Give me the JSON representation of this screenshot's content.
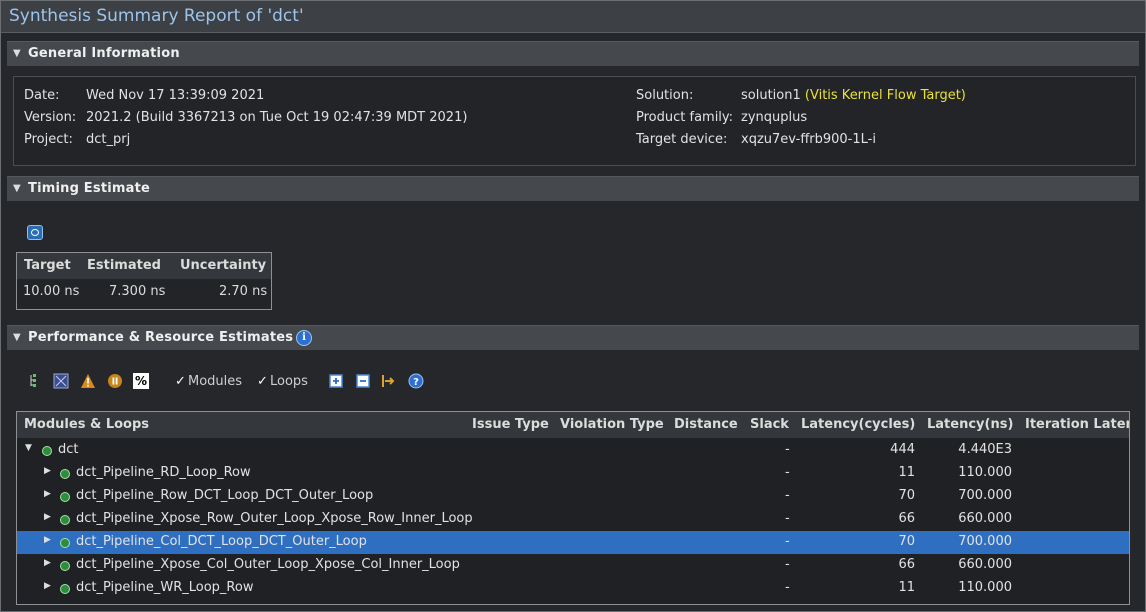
{
  "title": "Synthesis Summary Report of 'dct'",
  "sections": {
    "general": "General Information",
    "timing": "Timing Estimate",
    "perf": "Performance & Resource Estimates"
  },
  "general": {
    "date_label": "Date:",
    "date_value": "Wed Nov 17 13:39:09 2021",
    "version_label": "Version:",
    "version_value": "2021.2 (Build 3367213 on Tue Oct 19 02:47:39 MDT 2021)",
    "project_label": "Project:",
    "project_value": "dct_prj",
    "solution_label": "Solution:",
    "solution_value": "solution1",
    "solution_extra": "(Vitis Kernel Flow Target)",
    "family_label": "Product family:",
    "family_value": "zynquplus",
    "device_label": "Target device:",
    "device_value": "xqzu7ev-ffrb900-1L-i"
  },
  "timing": {
    "headers": [
      "Target",
      "Estimated",
      "Uncertainty"
    ],
    "values": [
      "10.00 ns",
      "7.300 ns",
      "2.70 ns"
    ]
  },
  "toolbar": {
    "modules_label": "Modules",
    "loops_label": "Loops",
    "percent_label": "%"
  },
  "tree": {
    "headers": [
      "Modules & Loops",
      "Issue Type",
      "Violation Type",
      "Distance",
      "Slack",
      "Latency(cycles)",
      "Latency(ns)",
      "Iteration Latency"
    ],
    "root": {
      "name": "dct",
      "slack": "-",
      "cycles": "444",
      "ns": "4.440E3"
    },
    "rows": [
      {
        "name": "dct_Pipeline_RD_Loop_Row",
        "slack": "-",
        "cycles": "11",
        "ns": "110.000"
      },
      {
        "name": "dct_Pipeline_Row_DCT_Loop_DCT_Outer_Loop",
        "slack": "-",
        "cycles": "70",
        "ns": "700.000"
      },
      {
        "name": "dct_Pipeline_Xpose_Row_Outer_Loop_Xpose_Row_Inner_Loop",
        "slack": "-",
        "cycles": "66",
        "ns": "660.000"
      },
      {
        "name": "dct_Pipeline_Col_DCT_Loop_DCT_Outer_Loop",
        "slack": "-",
        "cycles": "70",
        "ns": "700.000"
      },
      {
        "name": "dct_Pipeline_Xpose_Col_Outer_Loop_Xpose_Col_Inner_Loop",
        "slack": "-",
        "cycles": "66",
        "ns": "660.000"
      },
      {
        "name": "dct_Pipeline_WR_Loop_Row",
        "slack": "-",
        "cycles": "11",
        "ns": "110.000"
      }
    ]
  },
  "colors": {
    "selected_row": "#2f6fc2",
    "title_text": "#9ec4ea",
    "highlight_text": "#e8e23a",
    "module_dot": "#2f8b3e"
  }
}
